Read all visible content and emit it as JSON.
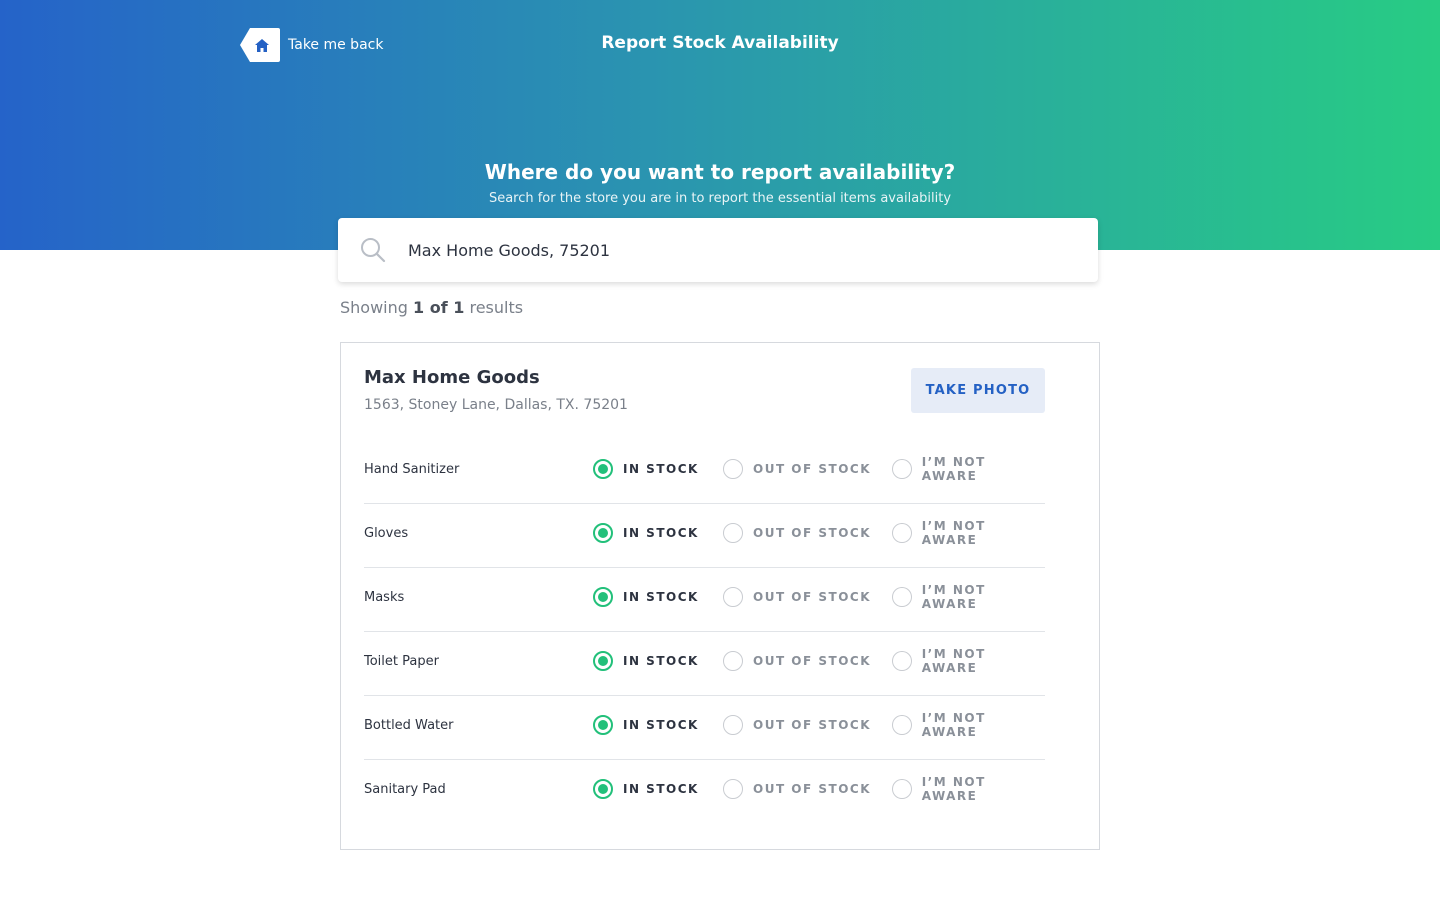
{
  "colors": {
    "gradient_start": "#2563c9",
    "gradient_end": "#28cc84",
    "accent_green": "#22c07a",
    "button_text": "#2461c4",
    "button_bg": "#e6ecf7"
  },
  "header": {
    "back_label": "Take me back",
    "back_icon": "home-icon",
    "title": "Report Stock Availability"
  },
  "hero": {
    "heading": "Where do you want to report availability?",
    "subheading": "Search for the store you are in to report the essential items availability"
  },
  "search": {
    "icon": "search-icon",
    "value": "Max Home Goods, 75201"
  },
  "results": {
    "prefix": "Showing",
    "count": "1 of 1",
    "suffix": "results"
  },
  "store": {
    "name": "Max Home Goods",
    "address": "1563, Stoney Lane, Dallas, TX. 75201",
    "photo_button": "TAKE PHOTO",
    "options": {
      "in_stock": "IN STOCK",
      "out_of_stock": "OUT OF STOCK",
      "not_aware": "I’M NOT AWARE"
    },
    "items": [
      {
        "name": "Hand Sanitizer",
        "selected": "in_stock"
      },
      {
        "name": "Gloves",
        "selected": "in_stock"
      },
      {
        "name": "Masks",
        "selected": "in_stock"
      },
      {
        "name": "Toilet Paper",
        "selected": "in_stock"
      },
      {
        "name": "Bottled Water",
        "selected": "in_stock"
      },
      {
        "name": "Sanitary Pad",
        "selected": "in_stock"
      }
    ]
  }
}
